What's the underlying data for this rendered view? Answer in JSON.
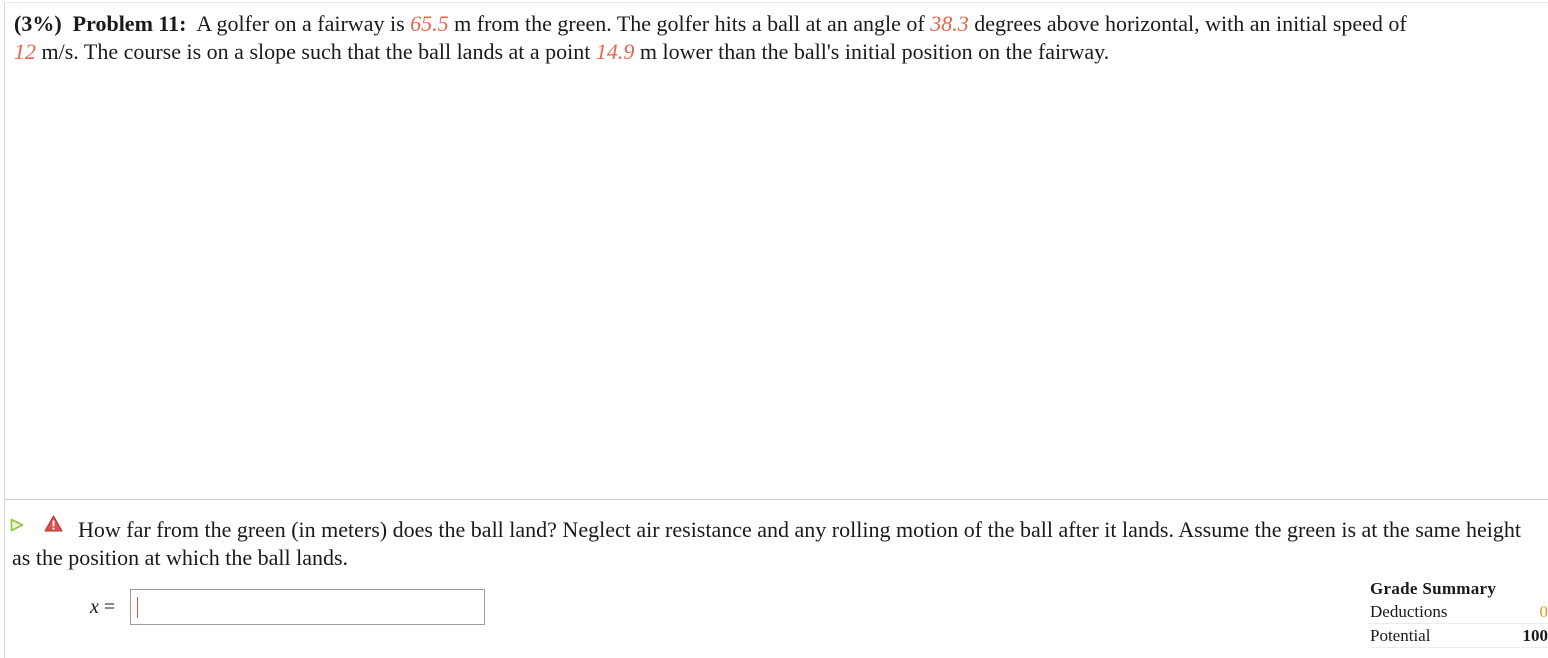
{
  "problem": {
    "weight": "(3%)",
    "label": "Problem 11:",
    "text_1": "A golfer on a fairway is",
    "distance": "65.5",
    "text_2": "m from the green. The golfer hits a ball at an angle of",
    "angle": "38.3",
    "text_3": "degrees above horizontal, with an initial speed of",
    "speed": "12",
    "text_4": "m/s. The course is on a slope such that the ball lands at a point",
    "drop": "14.9",
    "text_5": "m lower than the ball's initial position on the fairway."
  },
  "question": {
    "text": "How far from the green (in meters) does the ball land? Neglect air resistance and any rolling motion of the ball after it lands. Assume the green is at the same height as the position at which the ball lands.",
    "answer_variable": "x",
    "answer_equals": "=",
    "answer_value": ""
  },
  "grade_summary": {
    "title": "Grade Summary",
    "deductions_label": "Deductions",
    "deductions_value": "0",
    "potential_label": "Potential",
    "potential_value": "100"
  },
  "colors": {
    "given_value": "#e8644d",
    "deductions_value": "#e8961c",
    "play_icon": "#8cc63f",
    "warning_icon": "#d9534f"
  },
  "icons": {
    "play": "play-triangle-icon",
    "warning": "warning-triangle-icon"
  }
}
